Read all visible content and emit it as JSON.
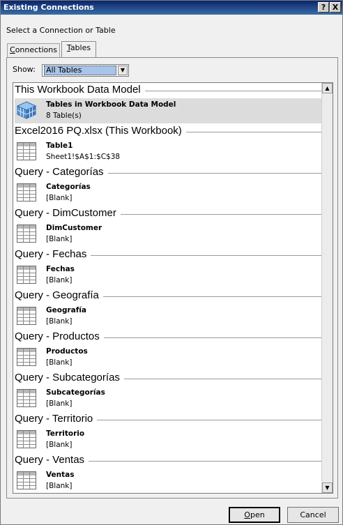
{
  "window": {
    "title": "Existing Connections",
    "help_glyph": "?",
    "close_glyph": "X"
  },
  "subtitle": "Select a Connection or Table",
  "tabs": [
    {
      "label_prefix": "",
      "label_underlined": "C",
      "label_rest": "onnections",
      "active": false
    },
    {
      "label_prefix": "",
      "label_underlined": "T",
      "label_rest": "ables",
      "active": true
    }
  ],
  "show": {
    "label": "Show:",
    "value": "All Tables"
  },
  "groups": [
    {
      "title": "This Workbook Data Model",
      "items": [
        {
          "name": "Tables in Workbook Data Model",
          "desc": "8 Table(s)",
          "icon": "data-model-cube-icon",
          "selected": true
        }
      ]
    },
    {
      "title": "Excel2016 PQ.xlsx (This Workbook)",
      "items": [
        {
          "name": "Table1",
          "desc": "Sheet1!$A$1:$C$38",
          "icon": "table-icon"
        }
      ]
    },
    {
      "title": "Query - Categorías",
      "items": [
        {
          "name": "Categorías",
          "desc": "[Blank]",
          "icon": "table-icon"
        }
      ]
    },
    {
      "title": "Query - DimCustomer",
      "items": [
        {
          "name": "DimCustomer",
          "desc": "[Blank]",
          "icon": "table-icon"
        }
      ]
    },
    {
      "title": "Query - Fechas",
      "items": [
        {
          "name": "Fechas",
          "desc": "[Blank]",
          "icon": "table-icon"
        }
      ]
    },
    {
      "title": "Query - Geografía",
      "items": [
        {
          "name": "Geografía",
          "desc": "[Blank]",
          "icon": "table-icon"
        }
      ]
    },
    {
      "title": "Query - Productos",
      "items": [
        {
          "name": "Productos",
          "desc": "[Blank]",
          "icon": "table-icon"
        }
      ]
    },
    {
      "title": "Query - Subcategorías",
      "items": [
        {
          "name": "Subcategorías",
          "desc": "[Blank]",
          "icon": "table-icon"
        }
      ]
    },
    {
      "title": "Query - Territorio",
      "items": [
        {
          "name": "Territorio",
          "desc": "[Blank]",
          "icon": "table-icon"
        }
      ]
    },
    {
      "title": "Query - Ventas",
      "items": [
        {
          "name": "Ventas",
          "desc": "[Blank]",
          "icon": "table-icon"
        }
      ]
    }
  ],
  "buttons": {
    "open_underlined": "O",
    "open_rest": "pen",
    "cancel": "Cancel"
  }
}
